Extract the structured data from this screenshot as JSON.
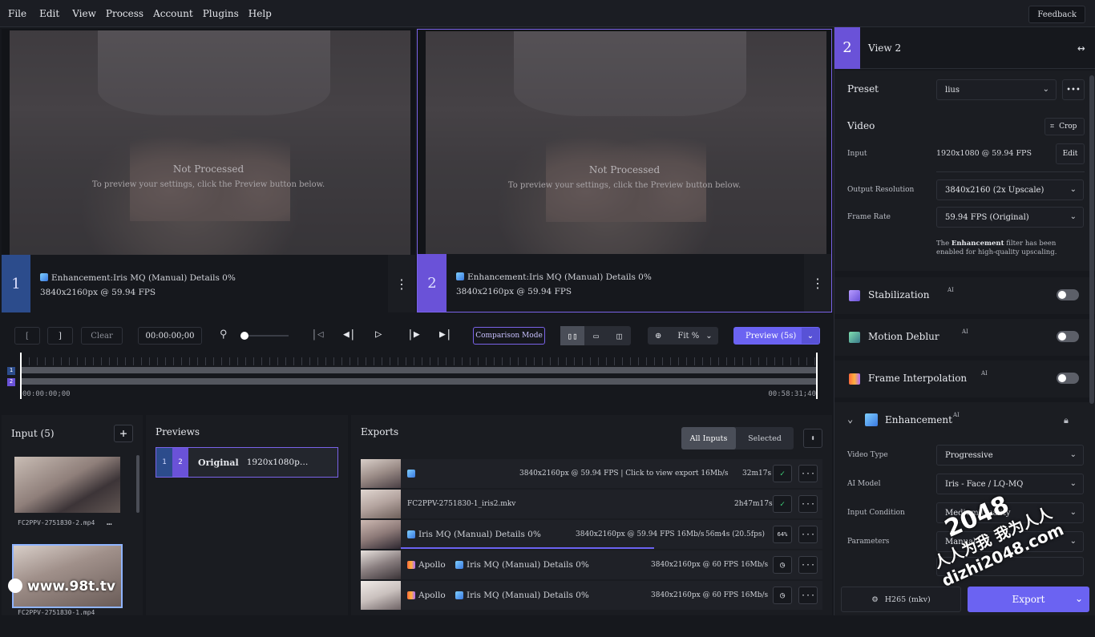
{
  "menu": [
    "File",
    "Edit",
    "View",
    "Process",
    "Account",
    "Plugins",
    "Help"
  ],
  "feedback_label": "Feedback",
  "views": [
    {
      "number": "1",
      "not_processed": "Not Processed",
      "hint": "To preview your settings, click the Preview button below.",
      "filter": "Enhancement:Iris MQ (Manual) Details 0%",
      "res": "3840x2160px @ 59.94 FPS"
    },
    {
      "number": "2",
      "not_processed": "Not Processed",
      "hint": "To preview your settings, click the Preview button below.",
      "filter": "Enhancement:Iris MQ (Manual) Details 0%",
      "res": "3840x2160px @ 59.94 FPS"
    }
  ],
  "transport": {
    "in_mark": "[",
    "out_mark": "]",
    "clear": "Clear",
    "timecode": "00:00:00;00",
    "comparison": "Comparison Mode",
    "fit": "Fit %",
    "preview": "Preview (5s)"
  },
  "timeline": {
    "start": "00:00:00;00",
    "end": "00:58:31;40"
  },
  "input": {
    "title": "Input (5)",
    "files": [
      "FC2PPV-2751830-2.mp4",
      "FC2PPV-2751830-1.mp4"
    ]
  },
  "previews": {
    "title": "Previews",
    "item_label": "Original",
    "item_res": "1920x1080p…"
  },
  "exports": {
    "title": "Exports",
    "all_inputs": "All Inputs",
    "selected": "Selected",
    "rows": [
      {
        "label": "",
        "meta": "3840x2160px @ 59.94 FPS | Click to view export 16Mb/s",
        "time": "32m17s"
      },
      {
        "label": "FC2PPV-2751830-1_iris2.mkv",
        "meta": "",
        "time": "2h47m17s"
      },
      {
        "label": "Iris MQ (Manual) Details 0%",
        "meta": "3840x2160px @ 59.94 FPS 16Mb/s",
        "time": "56m4s (20.5fps)",
        "pct": "64%"
      },
      {
        "label": "Apollo",
        "label2": "Iris MQ (Manual) Details 0%",
        "meta": "3840x2160px @ 60 FPS 16Mb/s",
        "time": ""
      },
      {
        "label": "Apollo",
        "label2": "Iris MQ (Manual) Details 0%",
        "meta": "3840x2160px @ 60 FPS 16Mb/s",
        "time": ""
      }
    ]
  },
  "panel": {
    "num": "2",
    "title": "View 2",
    "preset_label": "Preset",
    "preset_value": "lius",
    "video_label": "Video",
    "crop": "Crop",
    "input_label": "Input",
    "input_value": "1920x1080 @ 59.94 FPS",
    "edit": "Edit",
    "outres_label": "Output Resolution",
    "outres_value": "3840x2160 (2x Upscale)",
    "fps_label": "Frame Rate",
    "fps_value": "59.94 FPS (Original)",
    "note_pre": "The ",
    "note_bold": "Enhancement",
    "note_post": " filter has been enabled for high-quality upscaling.",
    "stabilization": "Stabilization",
    "motion_deblur": "Motion Deblur",
    "frame_interp": "Frame Interpolation",
    "ai": "AI",
    "enhancement": "Enhancement",
    "vtype_label": "Video Type",
    "vtype_value": "Progressive",
    "model_label": "AI Model",
    "model_value": "Iris - Face / LQ-MQ",
    "cond_label": "Input Condition",
    "cond_value": "Medium Quality",
    "params_label": "Parameters",
    "params_value": "Manual",
    "codec": "H265 (mkv)",
    "export": "Export"
  },
  "watermarks": {
    "left": "www.98t.tv",
    "right_top": "2048",
    "right_mid": "人人为我 我为人人",
    "right_bot": "dizhi2048.com"
  }
}
